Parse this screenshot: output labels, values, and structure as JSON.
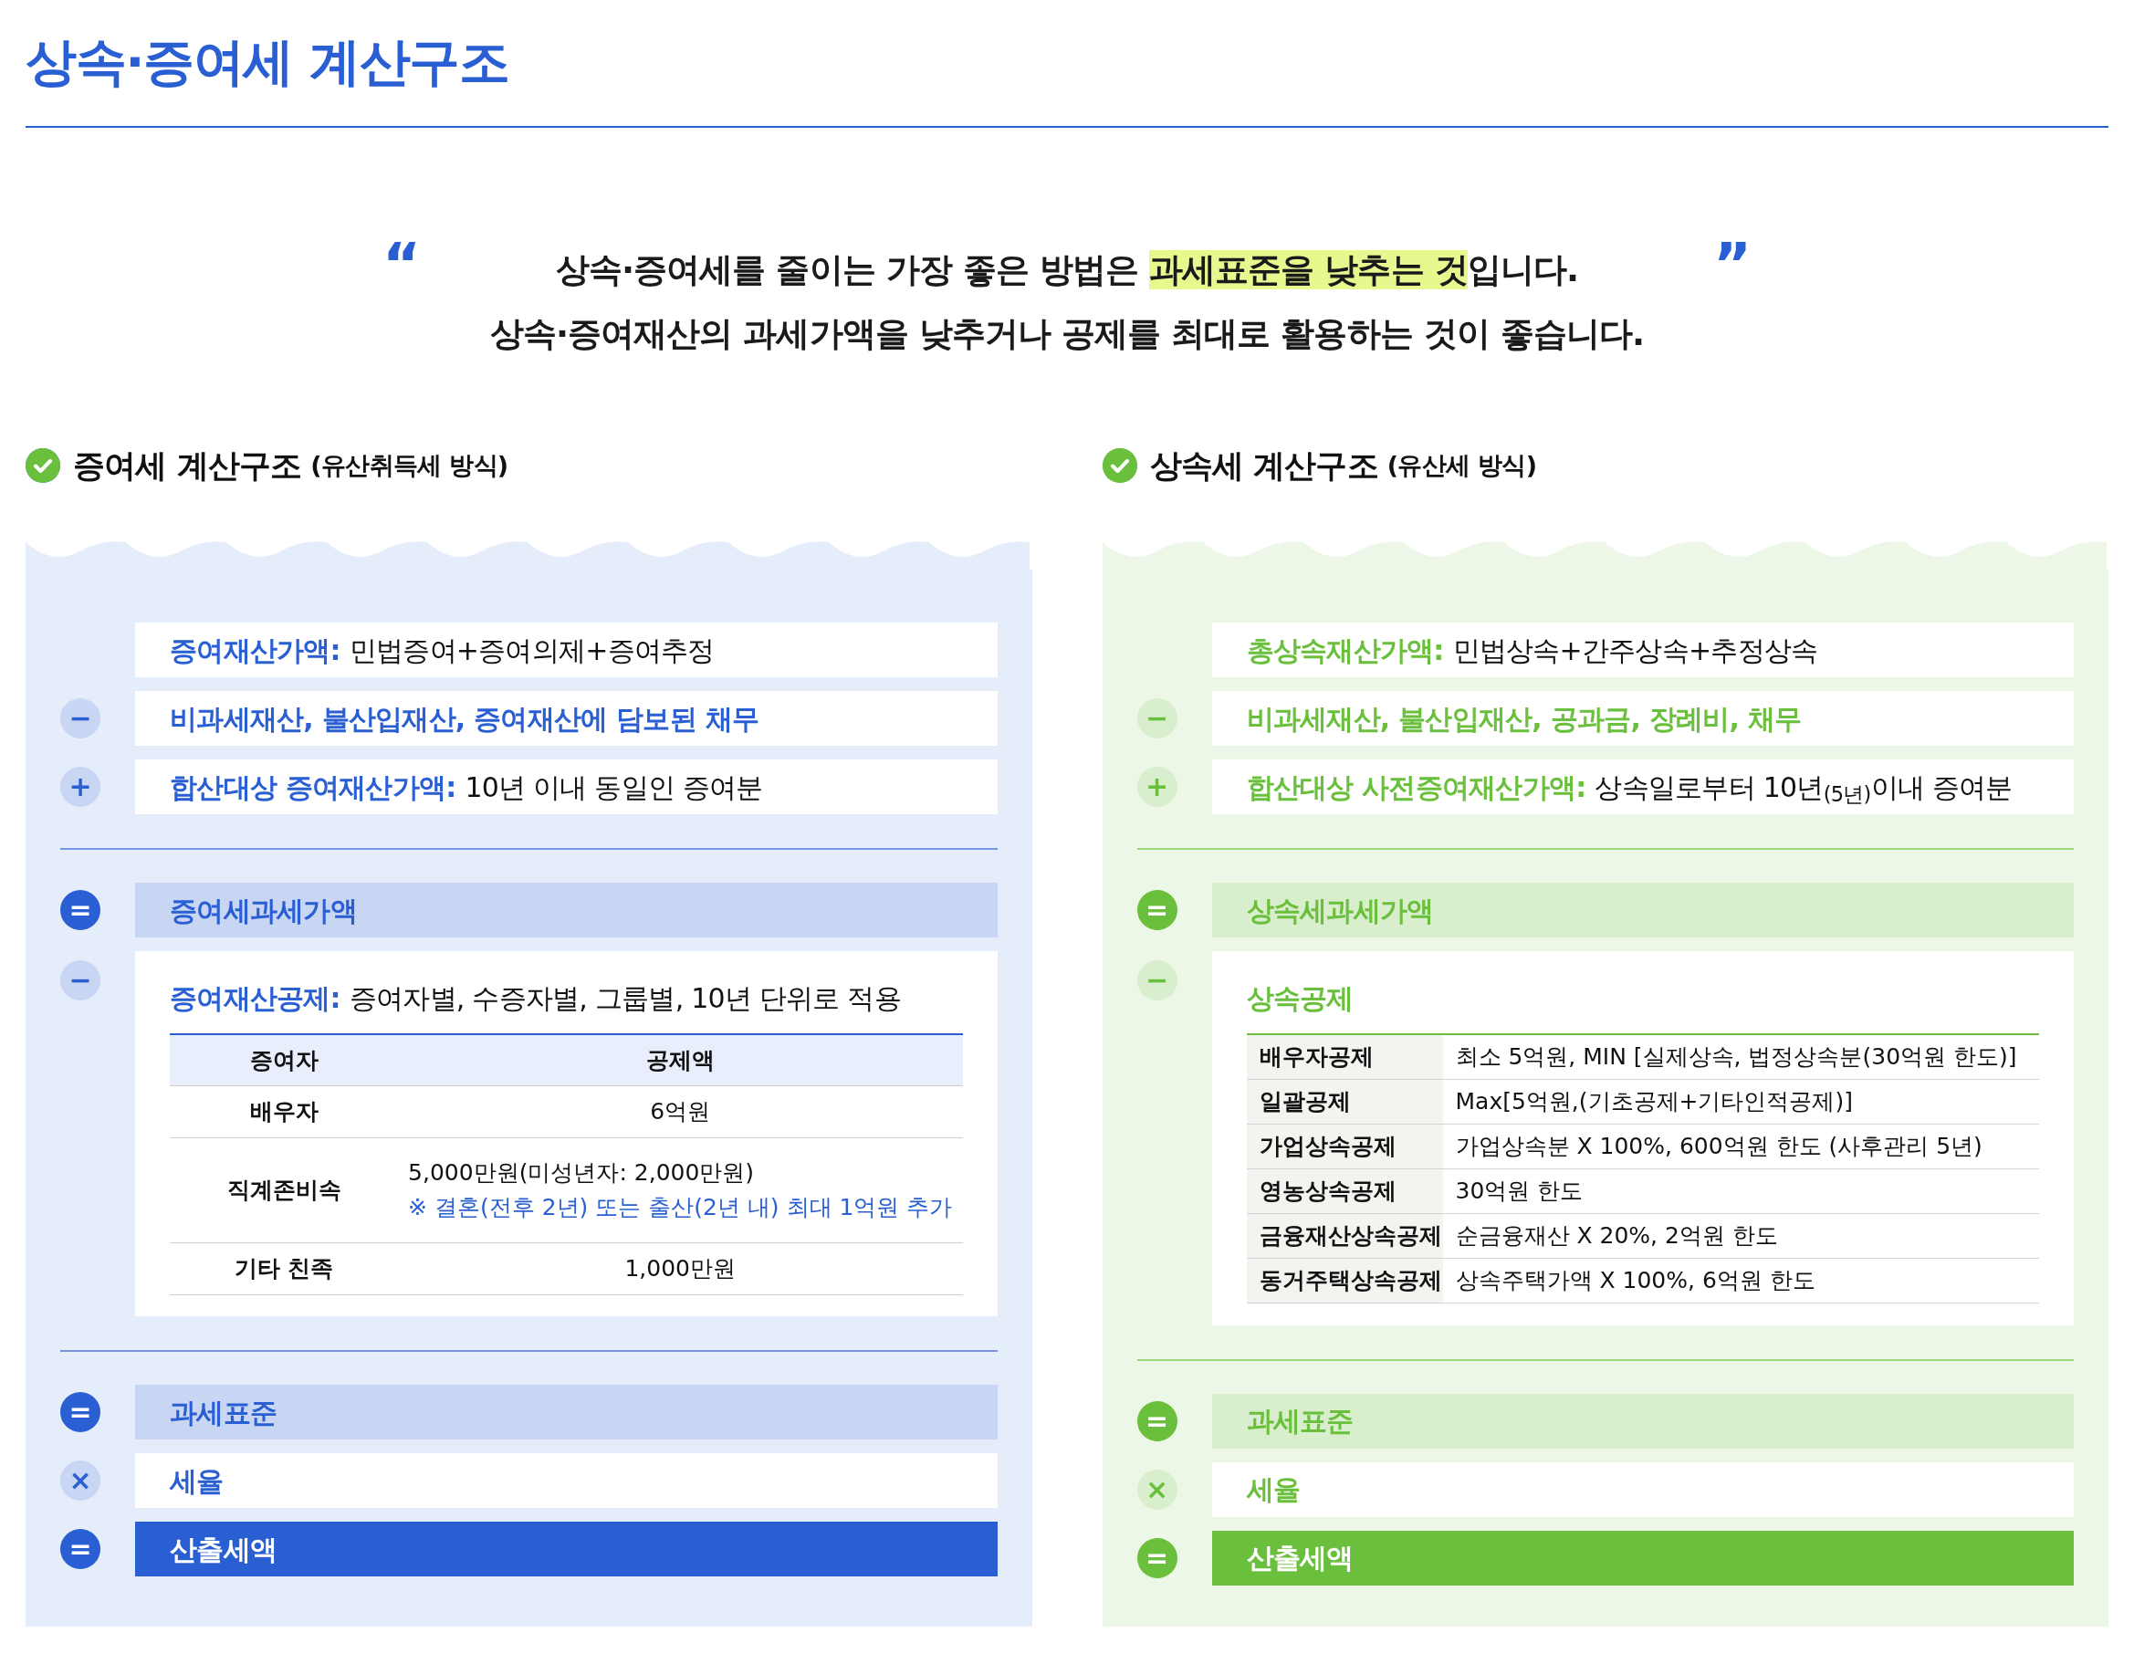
{
  "title": "상속·증여세 계산구조",
  "quote": {
    "open": "“",
    "close": "”",
    "lines": [
      {
        "before": "상속·증여세를 줄이는 가장 좋은 방법은 ",
        "highlight": "과세표준을 낮추는 것",
        "after": "입니다."
      },
      {
        "before": "상속·증여재산의 과세가액을 낮추거나 공제를 최대로 활용하는 것이 좋습니다."
      }
    ]
  },
  "panels": [
    {
      "heading": "증여세 계산구조",
      "subheading": "(유산취득세 방식)",
      "color": "#2a5fd3",
      "items": [
        {
          "kind": "plain",
          "label": "증여재산가액:",
          "detail": "민법증여+증여의제+증여추정"
        },
        {
          "kind": "plain",
          "operator": "−",
          "label": "비과세재산, 불산입재산, 증여재산에 담보된 채무"
        },
        {
          "kind": "plain",
          "operator": "+",
          "label": "합산대상 증여재산가액:",
          "detail": "10년 이내 동일인 증여분"
        },
        {
          "kind": "divider"
        },
        {
          "kind": "subtotal",
          "operator": "=",
          "label": "증여세과세가액"
        },
        {
          "kind": "deduction",
          "operator": "−",
          "label": "증여재산공제:",
          "detail": "증여자별, 수증자별, 그룹별, 10년 단위로 적용",
          "table": {
            "columns": [
              "증여자",
              "공제액"
            ],
            "rows": [
              {
                "cells": [
                  "배우자",
                  "6억원"
                ]
              },
              {
                "cells": [
                  "직계존비속",
                  "5,000만원(미성년자: 2,000만원)"
                ],
                "note": "※ 결혼(전후 2년) 또는 출산(2년 내) 최대 1억원 추가"
              },
              {
                "cells": [
                  "기타 친족",
                  "1,000만원"
                ]
              }
            ]
          }
        },
        {
          "kind": "divider"
        },
        {
          "kind": "subtotal",
          "operator": "=",
          "label": "과세표준"
        },
        {
          "kind": "plain",
          "operator": "×",
          "label": "세율"
        },
        {
          "kind": "result",
          "operator": "=",
          "label": "산출세액"
        }
      ]
    },
    {
      "heading": "상속세 계산구조",
      "subheading": "(유산세 방식)",
      "color": "#6abf3c",
      "items": [
        {
          "kind": "plain",
          "label": "총상속재산가액:",
          "detail": "민법상속+간주상속+추정상속"
        },
        {
          "kind": "plain",
          "operator": "−",
          "label": "비과세재산, 불산입재산, 공과금, 장례비, 채무"
        },
        {
          "kind": "plain",
          "operator": "+",
          "label": "합산대상 사전증여재산가액:",
          "detail": "상속일로부터 10년$_{(5년)}$이내 증여분"
        },
        {
          "kind": "divider"
        },
        {
          "kind": "subtotal",
          "operator": "=",
          "label": "상속세과세가액"
        },
        {
          "kind": "deduction",
          "operator": "−",
          "label": "상속공제",
          "table": {
            "rows": [
              {
                "cells": [
                  "배우자공제",
                  "최소 5억원, MIN [실제상속, 법정상속분(30억원 한도)]"
                ]
              },
              {
                "cells": [
                  "일괄공제",
                  "Max[5억원,(기초공제+기타인적공제)]"
                ]
              },
              {
                "cells": [
                  "가업상속공제",
                  "가업상속분 X 100%, 600억원 한도 (사후관리 5년)"
                ]
              },
              {
                "cells": [
                  "영농상속공제",
                  "30억원 한도"
                ]
              },
              {
                "cells": [
                  "금융재산상속공제",
                  "순금융재산 X 20%, 2억원 한도"
                ]
              },
              {
                "cells": [
                  "동거주택상속공제",
                  "상속주택가액 X 100%, 6억원 한도"
                ]
              }
            ]
          }
        },
        {
          "kind": "divider"
        },
        {
          "kind": "subtotal",
          "operator": "=",
          "label": "과세표준"
        },
        {
          "kind": "plain",
          "operator": "×",
          "label": "세율"
        },
        {
          "kind": "result",
          "operator": "=",
          "label": "산출세액"
        }
      ]
    }
  ]
}
